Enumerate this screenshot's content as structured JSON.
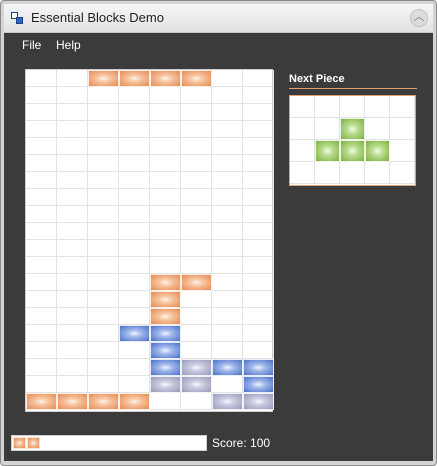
{
  "window": {
    "title": "Essential Blocks Demo",
    "app_icon": "blocks-app-icon",
    "collapse_icon": "chevron-up-icon"
  },
  "menu": {
    "items": [
      {
        "label": "File"
      },
      {
        "label": "Help"
      }
    ]
  },
  "board": {
    "cols": 8,
    "rows": 20,
    "falling_piece": {
      "color": "orange",
      "cells": [
        [
          0,
          2
        ],
        [
          0,
          3
        ],
        [
          0,
          4
        ],
        [
          0,
          5
        ]
      ]
    },
    "stack": [
      {
        "r": 12,
        "c": 4,
        "color": "orange"
      },
      {
        "r": 12,
        "c": 5,
        "color": "orange"
      },
      {
        "r": 13,
        "c": 4,
        "color": "orange"
      },
      {
        "r": 14,
        "c": 4,
        "color": "orange"
      },
      {
        "r": 15,
        "c": 3,
        "color": "blue"
      },
      {
        "r": 15,
        "c": 4,
        "color": "blue"
      },
      {
        "r": 16,
        "c": 4,
        "color": "blue"
      },
      {
        "r": 17,
        "c": 4,
        "color": "blue"
      },
      {
        "r": 17,
        "c": 5,
        "color": "lavender"
      },
      {
        "r": 17,
        "c": 6,
        "color": "blue"
      },
      {
        "r": 17,
        "c": 7,
        "color": "blue"
      },
      {
        "r": 18,
        "c": 4,
        "color": "lavender"
      },
      {
        "r": 18,
        "c": 5,
        "color": "lavender"
      },
      {
        "r": 18,
        "c": 7,
        "color": "blue"
      },
      {
        "r": 19,
        "c": 0,
        "color": "orange"
      },
      {
        "r": 19,
        "c": 1,
        "color": "orange"
      },
      {
        "r": 19,
        "c": 2,
        "color": "orange"
      },
      {
        "r": 19,
        "c": 3,
        "color": "orange"
      },
      {
        "r": 19,
        "c": 6,
        "color": "lavender"
      },
      {
        "r": 19,
        "c": 7,
        "color": "lavender"
      }
    ]
  },
  "next_piece": {
    "label": "Next Piece",
    "cols": 5,
    "rows": 4,
    "color": "green",
    "cells": [
      [
        1,
        2
      ],
      [
        2,
        1
      ],
      [
        2,
        2
      ],
      [
        2,
        3
      ]
    ]
  },
  "progress": {
    "filled_segments": 2,
    "color": "orange"
  },
  "score": {
    "text": "Score: 100",
    "value": 100
  },
  "colors": {
    "orange": "#e58a52",
    "blue": "#4a70c8",
    "lavender": "#9899b9",
    "green": "#7cb043",
    "background": "#3b3b3b",
    "accent": "#e2a272"
  }
}
